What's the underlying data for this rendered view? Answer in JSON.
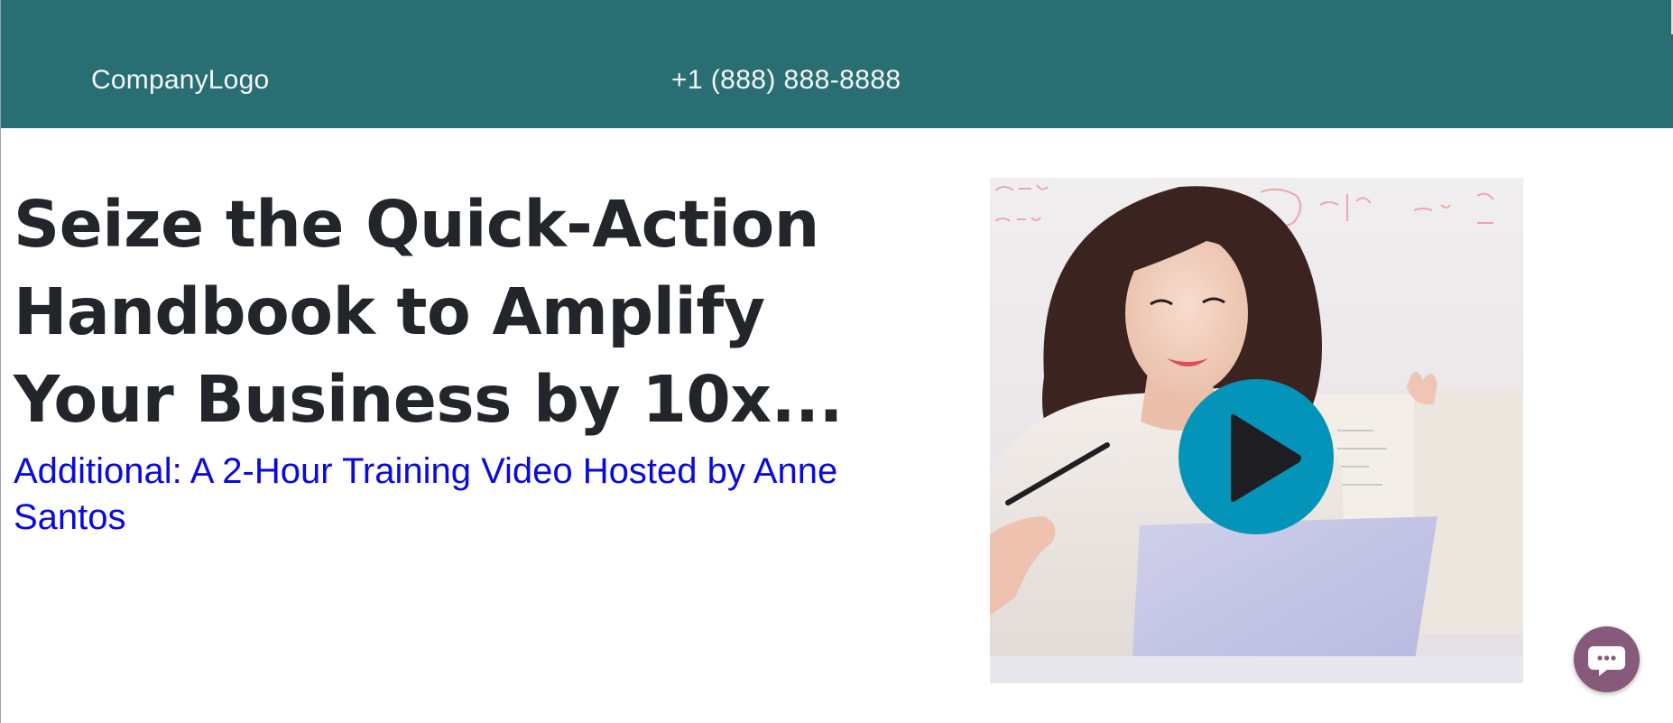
{
  "header": {
    "logo_text": "CompanyLogo",
    "phone": "+1 (888) 888-8888",
    "background_color": "#296e72"
  },
  "hero": {
    "headline": "Seize the Quick-Action Handbook to Amplify Your Business by 10x...",
    "subline": "Additional: A 2-Hour Training Video Hosted by Anne Santos",
    "subline_color": "#0a0ae0"
  },
  "video": {
    "thumbnail_icon": "woman-at-laptop-image",
    "play_icon": "play-icon",
    "play_button_color": "#0494b9"
  },
  "chat_widget": {
    "icon": "chat-bubble-icon",
    "color": "#875a7b"
  }
}
